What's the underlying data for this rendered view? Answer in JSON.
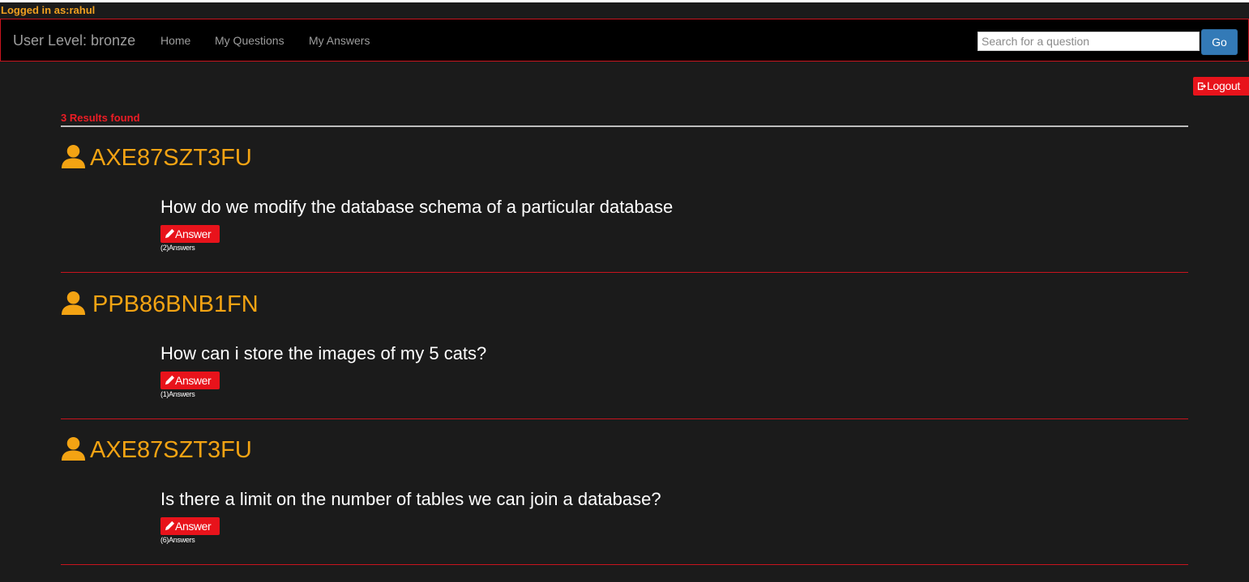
{
  "session": {
    "logged_in_text": "Logged in as:rahul"
  },
  "navbar": {
    "brand": "User Level: bronze",
    "links": [
      "Home",
      "My Questions",
      "My Answers"
    ],
    "search_placeholder": "Search for a question",
    "search_button": "Go"
  },
  "logout_label": "Logout",
  "results": {
    "count_text": "3 Results found",
    "items": [
      {
        "user": "AXE87SZT3FU",
        "question": "How do we modify the database schema of a particular database",
        "answer_label": "Answer",
        "answers_count": "(2)Answers"
      },
      {
        "user": "PPB86BNB1FN",
        "question": "How can i store the images of my 5 cats?",
        "answer_label": "Answer",
        "answers_count": "(1)Answers"
      },
      {
        "user": "AXE87SZT3FU",
        "question": "Is there a limit on the number of tables we can join a database?",
        "answer_label": "Answer",
        "answers_count": "(6)Answers"
      }
    ]
  },
  "colors": {
    "background": "#1b1b1b",
    "accent_orange": "#f3a313",
    "accent_red": "#e8131b",
    "go_blue": "#337ab7"
  }
}
